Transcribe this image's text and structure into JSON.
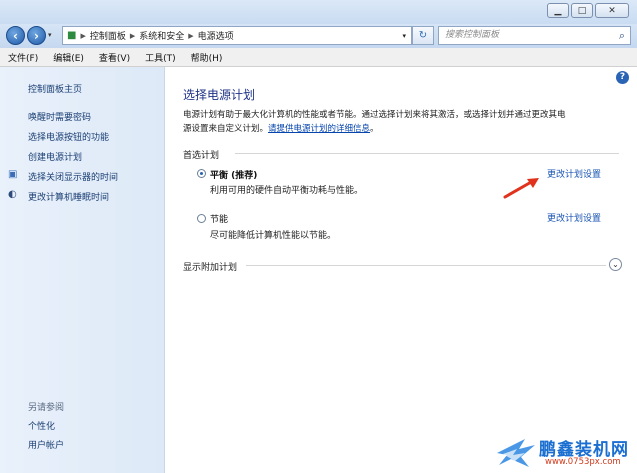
{
  "window": {
    "buttons": [
      "minimize",
      "maximize",
      "close"
    ]
  },
  "address": {
    "segments": [
      "控制面板",
      "系统和安全",
      "电源选项"
    ],
    "search_placeholder": "搜索控制面板"
  },
  "menu": [
    "文件(F)",
    "编辑(E)",
    "查看(V)",
    "工具(T)",
    "帮助(H)"
  ],
  "sidebar": {
    "home": "控制面板主页",
    "items": [
      {
        "label": "唤醒时需要密码"
      },
      {
        "label": "选择电源按钮的功能"
      },
      {
        "label": "创建电源计划"
      },
      {
        "label": "选择关闭显示器的时间",
        "icon": "monitor-icon"
      },
      {
        "label": "更改计算机睡眠时间",
        "icon": "moon-icon"
      }
    ],
    "see_also": "另请参阅",
    "see_also_items": [
      "个性化",
      "用户帐户"
    ]
  },
  "main": {
    "title": "选择电源计划",
    "desc_line1": "电源计划有助于最大化计算机的性能或者节能。通过选择计划来将其激活，或选择计划并通过更改其电",
    "desc_line2_prefix": "源设置来自定义计划。",
    "desc_link": "请提供电源计划的详细信息",
    "desc_suffix": "。",
    "group_title": "首选计划",
    "plans": [
      {
        "name": "平衡 (推荐)",
        "desc": "利用可用的硬件自动平衡功耗与性能。",
        "selected": true,
        "change": "更改计划设置"
      },
      {
        "name": "节能",
        "desc": "尽可能降低计算机性能以节能。",
        "selected": false,
        "change": "更改计划设置"
      }
    ],
    "show_more": "显示附加计划"
  },
  "watermark": {
    "title": "鹏鑫装机网",
    "url": "www.0753px.com"
  },
  "colors": {
    "accent": "#1a55b3",
    "title": "#1e3287",
    "arrow": "#e0321c"
  }
}
